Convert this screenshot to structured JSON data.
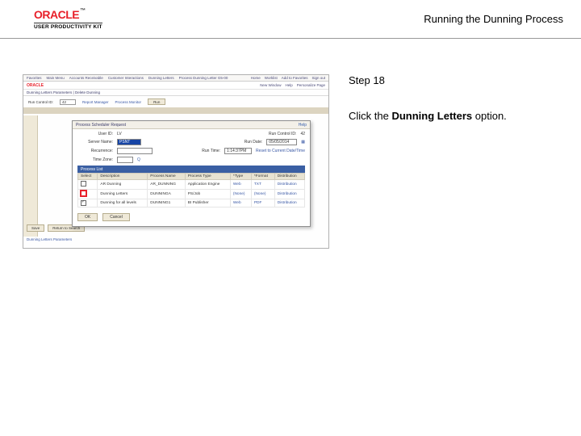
{
  "header": {
    "brand": "ORACLE",
    "sub": "USER PRODUCTIVITY KIT",
    "title": "Running the Dunning Process"
  },
  "right": {
    "step": "Step 18",
    "instr_pre": "Click the ",
    "instr_bold": "Dunning Letters",
    "instr_post": " option."
  },
  "mini": {
    "topnav_left": [
      "Favorites",
      "Main Menu",
      "Accounts Receivable",
      "Customer Interactions",
      "Dunning Letters",
      "Process Dunning Letter G5-00"
    ],
    "topnav_right": [
      "Home",
      "Worklist",
      "Add to Favorites",
      "Sign out"
    ],
    "brand": "ORACLE",
    "brandrow_right": [
      "New Window",
      "Help",
      "Personalize Page"
    ],
    "tabs": "Dunning Letters Parameters  |  Delete Dunning",
    "filters": {
      "runcontrol_label": "Run Control ID:",
      "runcontrol_value": "42",
      "reportmgr": "Report Manager",
      "procmon": "Process Monitor",
      "run_btn": "Run"
    },
    "modal": {
      "title": "Process Scheduler Request",
      "help": "Help",
      "user_label": "User ID:",
      "user_value": "LV",
      "runcontrol_label": "Run Control ID:",
      "runcontrol_value": "42",
      "server_label": "Server Name:",
      "server_value": "PSNT",
      "rundate_label": "Run Date:",
      "rundate_value": "05/05/2014",
      "recur_label": "Recurrence:",
      "recur_value": "",
      "runtime_label": "Run Time:",
      "runtime_value": "1:14:37PM",
      "reset_link": "Reset to Current Date/Time",
      "timezone_label": "Time Zone:",
      "timezone_lookup": "Q",
      "plist": "Process List",
      "table": {
        "headers": [
          "Select",
          "Description",
          "Process Name",
          "Process Type",
          "*Type",
          "*Format",
          "Distribution"
        ],
        "rows": [
          {
            "sel": false,
            "desc": "AR Dunning",
            "pname": "AR_DUNNING",
            "ptype": "Application Engine",
            "type": "Web",
            "format": "TXT",
            "dist": "Distribution"
          },
          {
            "sel": false,
            "red": true,
            "desc": "Dunning Letters",
            "pname": "DUNNINGA",
            "ptype": "PS/Job",
            "type": "(None)",
            "format": "(None)",
            "dist": "Distribution"
          },
          {
            "sel": true,
            "desc": "Dunning for all levels",
            "pname": "DUNNING1",
            "ptype": "BI Publisher",
            "type": "Web",
            "format": "PDF",
            "dist": "Distribution"
          }
        ]
      },
      "ok": "OK",
      "cancel": "Cancel"
    },
    "lower_buttons": [
      "Save",
      "Return to Search"
    ],
    "lower_link": "Dunning Letters Parameters"
  }
}
